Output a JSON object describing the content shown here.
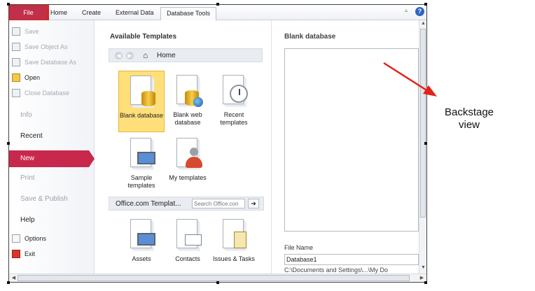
{
  "ribbon": {
    "tabs": [
      "File",
      "Home",
      "Create",
      "External Data",
      "Database Tools"
    ]
  },
  "nav": {
    "commands": [
      {
        "label": "Save",
        "state": "disabled"
      },
      {
        "label": "Save Object As",
        "state": "disabled"
      },
      {
        "label": "Save Database As",
        "state": "disabled"
      },
      {
        "label": "Open",
        "state": "enabled"
      },
      {
        "label": "Close Database",
        "state": "disabled"
      }
    ],
    "info": "Info",
    "recent": "Recent",
    "new": "New",
    "print": "Print",
    "save_publish": "Save & Publish",
    "help": "Help",
    "options": "Options",
    "exit": "Exit"
  },
  "templates": {
    "title": "Available Templates",
    "breadcrumb": "Home",
    "tiles": [
      {
        "label": "Blank database",
        "icon": "blank-database-icon"
      },
      {
        "label": "Blank web database",
        "icon": "blank-web-database-icon"
      },
      {
        "label": "Recent templates",
        "icon": "recent-templates-icon"
      },
      {
        "label": "Sample templates",
        "icon": "sample-templates-icon"
      },
      {
        "label": "My templates",
        "icon": "my-templates-icon"
      }
    ],
    "office_label": "Office.com Templat...",
    "office_search_placeholder": "Search Office.con",
    "office_tiles": [
      {
        "label": "Assets",
        "icon": "assets-icon"
      },
      {
        "label": "Contacts",
        "icon": "contacts-icon"
      },
      {
        "label": "Issues & Tasks",
        "icon": "issues-tasks-icon"
      }
    ]
  },
  "preview": {
    "title": "Blank database",
    "file_name_label": "File Name",
    "file_name_value": "Database1",
    "path": "C:\\Documents and Settings\\...\\My Do"
  },
  "annotation": {
    "text": "Backstage view"
  },
  "colors": {
    "file_tab": "#c0304a",
    "highlight_box": "#d7261d",
    "selected_nav": "#c8284c",
    "selected_tile": "#ffdf7a",
    "annotation_arrow": "#e2231a"
  }
}
